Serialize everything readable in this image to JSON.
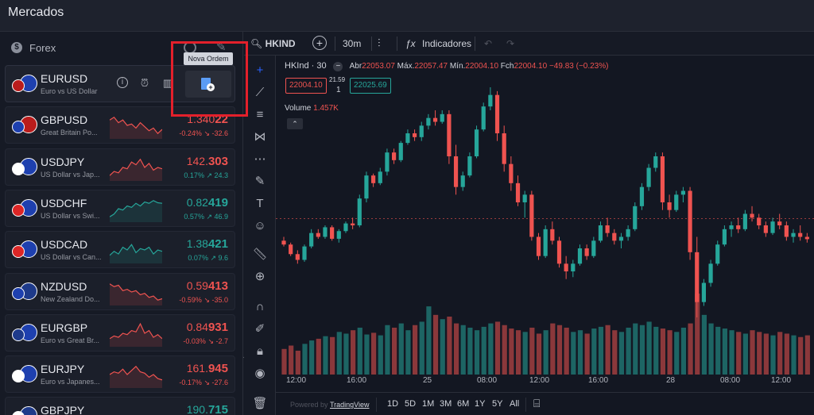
{
  "header": {
    "title": "Mercados"
  },
  "sidebar": {
    "section_label": "Forex",
    "tooltip": "Nova Ordem",
    "pairs": [
      {
        "symbol": "EURUSD",
        "desc": "Euro vs US Dollar",
        "price_main": "",
        "price_big": "",
        "change": "",
        "dir": "up",
        "spark": []
      },
      {
        "symbol": "GBPUSD",
        "desc": "Great Britain Po...",
        "price_main": "1.340",
        "price_big": "22",
        "change": "-0.24% ↘ -32.6",
        "dir": "dn",
        "spark": [
          0.7,
          0.8,
          0.6,
          0.7,
          0.5,
          0.55,
          0.4,
          0.6,
          0.45,
          0.3,
          0.4,
          0.2,
          0.35
        ]
      },
      {
        "symbol": "USDJPY",
        "desc": "US Dollar vs Jap...",
        "price_main": "142.",
        "price_big": "303",
        "change": "0.17% ↗ 24.3",
        "dir": "dn",
        "spark": [
          0.2,
          0.35,
          0.3,
          0.5,
          0.45,
          0.7,
          0.6,
          0.8,
          0.5,
          0.65,
          0.4,
          0.5,
          0.45
        ]
      },
      {
        "symbol": "USDCHF",
        "desc": "US Dollar vs Swi...",
        "price_main": "0.82",
        "price_big": "419",
        "change": "0.57% ↗ 46.9",
        "dir": "up",
        "spark": [
          0.2,
          0.3,
          0.5,
          0.45,
          0.6,
          0.55,
          0.7,
          0.6,
          0.75,
          0.7,
          0.8,
          0.72,
          0.7
        ]
      },
      {
        "symbol": "USDCAD",
        "desc": "US Dollar vs Can...",
        "price_main": "1.38",
        "price_big": "421",
        "change": "0.07% ↗ 9.6",
        "dir": "up",
        "spark": [
          0.3,
          0.45,
          0.35,
          0.6,
          0.5,
          0.7,
          0.4,
          0.55,
          0.5,
          0.6,
          0.35,
          0.5,
          0.45
        ]
      },
      {
        "symbol": "NZDUSD",
        "desc": "New Zealand Do...",
        "price_main": "0.59",
        "price_big": "413",
        "change": "-0.59% ↘ -35.0",
        "dir": "dn",
        "spark": [
          0.8,
          0.7,
          0.75,
          0.55,
          0.6,
          0.5,
          0.55,
          0.4,
          0.45,
          0.3,
          0.35,
          0.2,
          0.25
        ]
      },
      {
        "symbol": "EURGBP",
        "desc": "Euro vs Great Br...",
        "price_main": "0.84",
        "price_big": "931",
        "change": "-0.03% ↘ -2.7",
        "dir": "dn",
        "spark": [
          0.3,
          0.4,
          0.35,
          0.5,
          0.45,
          0.6,
          0.55,
          0.85,
          0.5,
          0.6,
          0.35,
          0.45,
          0.3
        ]
      },
      {
        "symbol": "EURJPY",
        "desc": "Euro vs Japanes...",
        "price_main": "161.",
        "price_big": "945",
        "change": "-0.17% ↘ -27.6",
        "dir": "dn",
        "spark": [
          0.5,
          0.6,
          0.55,
          0.7,
          0.5,
          0.65,
          0.8,
          0.6,
          0.55,
          0.4,
          0.5,
          0.35,
          0.3
        ]
      },
      {
        "symbol": "GBPJPY",
        "desc": "",
        "price_main": "190.",
        "price_big": "715",
        "change": "",
        "dir": "up",
        "spark": []
      }
    ]
  },
  "chart_toolbar": {
    "symbol": "HKIND",
    "interval": "30m",
    "indicators": "Indicadores"
  },
  "legend": {
    "symbol": "HKInd · 30",
    "o_label": "Abr",
    "o": "22053.07",
    "h_label": "Máx.",
    "h": "22057.47",
    "l_label": "Mín.",
    "l": "22004.10",
    "c_label": "Fch",
    "c": "22004.10",
    "change": "−49.83 (−0.23%)"
  },
  "trade": {
    "sell": "22004.10",
    "spread": "21.59",
    "qty": "1",
    "buy": "22025.69"
  },
  "volume": {
    "label": "Volume",
    "value": "1.457K"
  },
  "time_axis": [
    "12:00",
    "16:00",
    "25",
    "08:00",
    "12:00",
    "16:00",
    "28",
    "08:00",
    "12:00"
  ],
  "bottom": {
    "powered": "Powered by",
    "tradingview": "TradingView",
    "ranges": [
      "1D",
      "5D",
      "1M",
      "3M",
      "6M",
      "1Y",
      "5Y",
      "All"
    ]
  },
  "colors": {
    "up": "#26a69a",
    "down": "#ef5350",
    "highlight": "#e4202b"
  },
  "chart_data": {
    "type": "candlestick",
    "candles": [
      [
        22000,
        22010,
        21985,
        21990
      ],
      [
        21990,
        21995,
        21960,
        21965
      ],
      [
        21965,
        21975,
        21940,
        21950
      ],
      [
        21950,
        21990,
        21945,
        21985
      ],
      [
        21985,
        22030,
        21980,
        22020
      ],
      [
        22020,
        22030,
        22005,
        22010
      ],
      [
        22010,
        22040,
        22005,
        22035
      ],
      [
        22035,
        22040,
        22000,
        22005
      ],
      [
        22005,
        22030,
        21995,
        22025
      ],
      [
        22025,
        22050,
        22020,
        22045
      ],
      [
        22045,
        22060,
        22030,
        22040
      ],
      [
        22040,
        22120,
        22035,
        22110
      ],
      [
        22110,
        22180,
        22100,
        22170
      ],
      [
        22170,
        22175,
        22140,
        22150
      ],
      [
        22150,
        22190,
        22145,
        22180
      ],
      [
        22180,
        22240,
        22170,
        22230
      ],
      [
        22230,
        22240,
        22200,
        22210
      ],
      [
        22210,
        22260,
        22205,
        22255
      ],
      [
        22255,
        22290,
        22250,
        22280
      ],
      [
        22280,
        22290,
        22260,
        22270
      ],
      [
        22270,
        22310,
        22260,
        22300
      ],
      [
        22300,
        22330,
        22290,
        22320
      ],
      [
        22320,
        22340,
        22300,
        22310
      ],
      [
        22310,
        22340,
        22305,
        22330
      ],
      [
        22330,
        22340,
        22200,
        22220
      ],
      [
        22220,
        22250,
        22120,
        22140
      ],
      [
        22140,
        22180,
        22130,
        22170
      ],
      [
        22170,
        22230,
        22165,
        22220
      ],
      [
        22220,
        22300,
        22215,
        22290
      ],
      [
        22290,
        22360,
        22285,
        22350
      ],
      [
        22350,
        22400,
        22340,
        22380
      ],
      [
        22380,
        22390,
        22260,
        22280
      ],
      [
        22280,
        22300,
        22180,
        22200
      ],
      [
        22200,
        22220,
        22130,
        22150
      ],
      [
        22150,
        22170,
        22090,
        22100
      ],
      [
        22100,
        22130,
        22060,
        22120
      ],
      [
        22120,
        22130,
        22000,
        22010
      ],
      [
        22010,
        22020,
        21950,
        21960
      ],
      [
        21960,
        22040,
        21955,
        22030
      ],
      [
        22030,
        22050,
        21990,
        22000
      ],
      [
        22000,
        22010,
        21930,
        21940
      ],
      [
        21940,
        21960,
        21900,
        21920
      ],
      [
        21920,
        21950,
        21905,
        21940
      ],
      [
        21940,
        21990,
        21935,
        21980
      ],
      [
        21980,
        21990,
        21950,
        21960
      ],
      [
        21960,
        22010,
        21955,
        22000
      ],
      [
        22000,
        22050,
        21995,
        22040
      ],
      [
        22040,
        22060,
        22010,
        22020
      ],
      [
        22020,
        22030,
        21990,
        22000
      ],
      [
        22000,
        22020,
        21980,
        22010
      ],
      [
        22010,
        22040,
        22000,
        22030
      ],
      [
        22030,
        22100,
        22025,
        22090
      ],
      [
        22090,
        22150,
        22080,
        22140
      ],
      [
        22140,
        22200,
        22130,
        22190
      ],
      [
        22190,
        22230,
        22180,
        22220
      ],
      [
        22220,
        22230,
        22080,
        22100
      ],
      [
        22100,
        22120,
        22060,
        22080
      ],
      [
        22080,
        22130,
        22075,
        22120
      ],
      [
        22120,
        22140,
        22100,
        22130
      ],
      [
        22130,
        22140,
        21950,
        21970
      ],
      [
        21970,
        22010,
        21800,
        21840
      ],
      [
        21840,
        21900,
        21830,
        21890
      ],
      [
        21890,
        21950,
        21880,
        21940
      ],
      [
        21940,
        22000,
        21935,
        21990
      ],
      [
        21990,
        22040,
        21985,
        22030
      ],
      [
        22030,
        22050,
        22010,
        22040
      ],
      [
        22040,
        22060,
        22020,
        22030
      ],
      [
        22030,
        22080,
        22025,
        22070
      ],
      [
        22070,
        22090,
        22050,
        22060
      ],
      [
        22060,
        22070,
        22030,
        22040
      ],
      [
        22040,
        22050,
        22010,
        22020
      ],
      [
        22020,
        22060,
        22015,
        22050
      ],
      [
        22050,
        22070,
        22030,
        22040
      ],
      [
        22040,
        22050,
        22000,
        22010
      ],
      [
        22010,
        22030,
        21995,
        22020
      ],
      [
        22020,
        22040,
        22000,
        22010
      ],
      [
        22010,
        22020,
        21995,
        22004
      ]
    ],
    "volumes": [
      30,
      34,
      28,
      36,
      40,
      42,
      45,
      44,
      50,
      48,
      52,
      55,
      47,
      49,
      46,
      58,
      55,
      60,
      52,
      58,
      62,
      80,
      70,
      65,
      68,
      60,
      58,
      55,
      52,
      56,
      60,
      62,
      58,
      54,
      52,
      50,
      55,
      48,
      52,
      60,
      58,
      55,
      50,
      52,
      48,
      54,
      56,
      58,
      52,
      50,
      55,
      60,
      58,
      62,
      56,
      54,
      52,
      50,
      55,
      60,
      95,
      70,
      60,
      56,
      54,
      52,
      50,
      48,
      52,
      50,
      48,
      46,
      50,
      48,
      46,
      44,
      46
    ],
    "last_price": 22004.1,
    "dashed_level": 22057.47
  }
}
